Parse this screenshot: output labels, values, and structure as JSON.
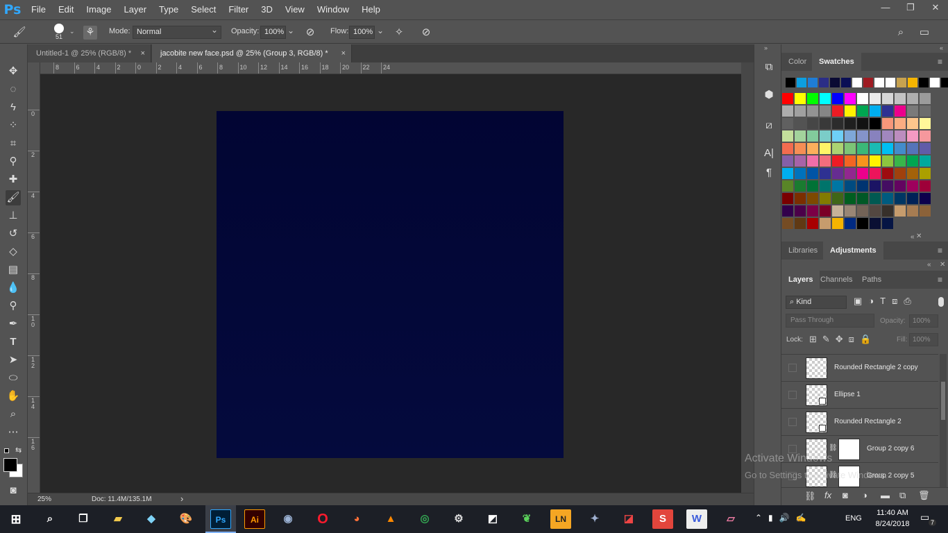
{
  "app": {
    "logo": "Ps"
  },
  "menu": [
    "File",
    "Edit",
    "Image",
    "Layer",
    "Type",
    "Select",
    "Filter",
    "3D",
    "View",
    "Window",
    "Help"
  ],
  "window_controls": {
    "minimize": "—",
    "restore": "❐",
    "close": "✕"
  },
  "options_bar": {
    "brush_size": "51",
    "mode_label": "Mode:",
    "mode_value": "Normal",
    "opacity_label": "Opacity:",
    "opacity_value": "100%",
    "flow_label": "Flow:",
    "flow_value": "100%"
  },
  "doc_tabs": [
    {
      "title": "Untitled-1 @ 25% (RGB/8) *",
      "close": "×"
    },
    {
      "title": "jacobite new face.psd @ 25% (Group 3, RGB/8) *",
      "close": "×"
    }
  ],
  "rulers": {
    "horizontal": [
      "8",
      "6",
      "4",
      "2",
      "0",
      "2",
      "4",
      "6",
      "8",
      "10",
      "12",
      "14",
      "16",
      "18",
      "20",
      "22",
      "24"
    ],
    "vertical": [
      "0",
      "2",
      "4",
      "6",
      "8",
      "1\n0",
      "1\n2",
      "1\n4",
      "1\n6"
    ]
  },
  "canvas": {
    "color": "#030838"
  },
  "status": {
    "zoom": "25%",
    "doc": "Doc: 11.4M/135.1M"
  },
  "color_panel": {
    "tabs": [
      "Color",
      "Swatches"
    ],
    "active_tab": "Swatches",
    "recent": [
      "#000000",
      "#0d9fe0",
      "#1f7dd6",
      "#2b2d86",
      "#0a0a33",
      "#0a0f55",
      "#ffffff",
      "#9e1b22",
      "#ffffff",
      "#ffffff",
      "#c7a24f",
      "#f5b400",
      "#000000",
      "#ffffff",
      "#000000"
    ],
    "swatches": [
      [
        "#ff0000",
        "#ffff00",
        "#00ff00",
        "#00ffff",
        "#0000ff",
        "#ff00ff",
        "#ffffff",
        "#ebebeb",
        "#d7d7d7",
        "#c3c3c3",
        "#afafaf",
        "#9b9b9b"
      ],
      [
        "#adadad",
        "#a0a0a0",
        "#939393",
        "#868686",
        "#ed1c24",
        "#fff200",
        "#00a651",
        "#00aeef",
        "#2e3192",
        "#ec008c",
        "#7a7a7a",
        "#6d6d6d"
      ],
      [
        "#606060",
        "#535353",
        "#464646",
        "#393939",
        "#2c2c2c",
        "#1f1f1f",
        "#121212",
        "#000000",
        "#f7977a",
        "#fbad82",
        "#fdc68c",
        "#fff799"
      ],
      [
        "#c4df9b",
        "#a3d39c",
        "#82ca9c",
        "#7bcdc8",
        "#6ecff6",
        "#7ea7d8",
        "#8493ca",
        "#8882be",
        "#a187be",
        "#bc8dbf",
        "#f49ac2",
        "#f6989d"
      ],
      [
        "#f26c4f",
        "#f68e55",
        "#fbaf5c",
        "#fff467",
        "#acd372",
        "#7cc576",
        "#3bb878",
        "#1abbb4",
        "#00bff3",
        "#438ccb",
        "#5574b9",
        "#605ca8"
      ],
      [
        "#855fa8",
        "#a763a8",
        "#f06ea9",
        "#f26d7d",
        "#ed1c24",
        "#f26522",
        "#f7941d",
        "#fff200",
        "#8dc63f",
        "#39b54a",
        "#00a651",
        "#00a99d"
      ],
      [
        "#00aeef",
        "#0072bc",
        "#0054a6",
        "#2e3192",
        "#662d91",
        "#92278f",
        "#ec008c",
        "#ed145b",
        "#9e0b0f",
        "#a0410d",
        "#a3620a",
        "#aba000"
      ],
      [
        "#598527",
        "#1a7b30",
        "#007236",
        "#00746b",
        "#0076a3",
        "#004b80",
        "#003471",
        "#1b1464",
        "#440e62",
        "#630460",
        "#9e005d",
        "#9e0039"
      ],
      [
        "#790000",
        "#7b2e00",
        "#7d4900",
        "#827b00",
        "#406618",
        "#005e20",
        "#005826",
        "#005952",
        "#005b7f",
        "#003663",
        "#002157",
        "#0d004c"
      ],
      [
        "#32004b",
        "#4b0049",
        "#7b0046",
        "#7a0026",
        "#c7b299",
        "#998675",
        "#736357",
        "#534741",
        "#37302a",
        "#c69c6d",
        "#a67c52",
        "#8c6239"
      ],
      [
        "#754c24",
        "#603913",
        "#a80000",
        "#c69c6d",
        "#f5b400",
        "#002a82",
        "#000000",
        "#0a0f33",
        "#061544"
      ]
    ]
  },
  "adjust_panel": {
    "tabs": [
      "Libraries",
      "Adjustments"
    ],
    "active_tab": "Adjustments"
  },
  "layers_panel": {
    "tabs": [
      "Layers",
      "Channels",
      "Paths"
    ],
    "active_tab": "Layers",
    "filter_label": "Kind",
    "blend_mode": "Pass Through",
    "opacity_label": "Opacity:",
    "opacity_value": "100%",
    "lock_label": "Lock:",
    "fill_label": "Fill:",
    "fill_value": "100%",
    "layers": [
      {
        "name": "Rounded Rectangle 2 copy",
        "mask": false,
        "shape": false
      },
      {
        "name": "Ellipse 1",
        "mask": false,
        "shape": true
      },
      {
        "name": "Rounded Rectangle 2",
        "mask": false,
        "shape": true
      },
      {
        "name": "Group 2 copy 6",
        "mask": true,
        "shape": false
      },
      {
        "name": "Group 2 copy 5",
        "mask": true,
        "shape": false
      }
    ],
    "footer_icons": [
      "link-icon",
      "fx-icon",
      "mask-icon",
      "adjustment-icon",
      "folder-icon",
      "new-layer-icon",
      "trash-icon"
    ]
  },
  "watermark": {
    "line1": "Activate Windows",
    "line2": "Go to Settings to activate Windows."
  },
  "taskbar": {
    "lang": "ENG",
    "time": "11:40 AM",
    "date": "8/24/2018",
    "notification_count": "7",
    "apps": [
      "start",
      "search",
      "task-view",
      "file-explorer",
      "app-blue",
      "paint",
      "photoshop",
      "illustrator",
      "cinema4d",
      "opera",
      "firefox",
      "vlc",
      "chrome",
      "settings",
      "sticky",
      "app-green",
      "ln",
      "app-star",
      "app-dark",
      "app-s",
      "app-w",
      "eraser"
    ]
  }
}
